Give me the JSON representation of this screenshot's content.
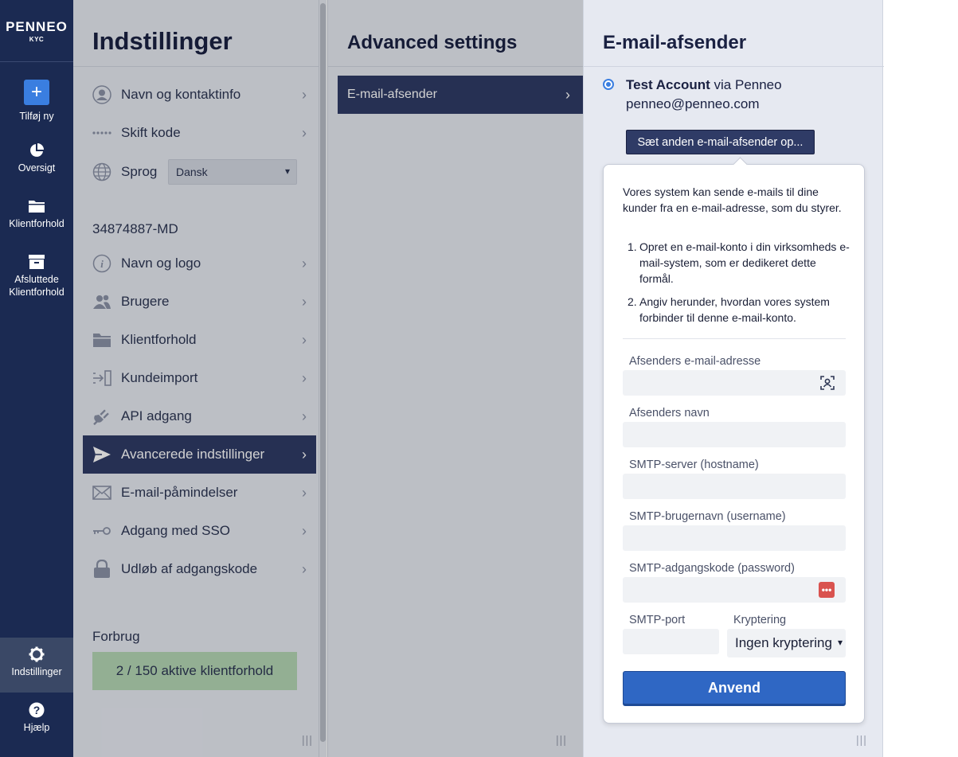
{
  "app": {
    "logo": "PENNEO",
    "logo_sub": "KYC"
  },
  "leftnav": {
    "add_label": "Tilføj ny",
    "overview_label": "Oversigt",
    "clients_label": "Klientforhold",
    "closed_label": "Afsluttede Klientforhold",
    "settings_label": "Indstillinger",
    "help_label": "Hjælp"
  },
  "settings": {
    "title": "Indstillinger",
    "personal_items": [
      {
        "label": "Navn og kontaktinfo",
        "icon": "user-icon"
      },
      {
        "label": "Skift kode",
        "icon": "password-dots-icon"
      }
    ],
    "language_label": "Sprog",
    "language_value": "Dansk",
    "org_id": "34874887-MD",
    "org_items": [
      {
        "label": "Navn og logo",
        "icon": "info-icon"
      },
      {
        "label": "Brugere",
        "icon": "users-icon"
      },
      {
        "label": "Klientforhold",
        "icon": "folder-icon"
      },
      {
        "label": "Kundeimport",
        "icon": "import-icon"
      },
      {
        "label": "API adgang",
        "icon": "plug-icon"
      },
      {
        "label": "Avancerede indstillinger",
        "icon": "send-icon",
        "active": true
      },
      {
        "label": "E-mail-påmindelser",
        "icon": "envelope-icon"
      },
      {
        "label": "Adgang med SSO",
        "icon": "key-icon"
      },
      {
        "label": "Udløb af adgangskode",
        "icon": "lock-icon"
      }
    ],
    "usage_title": "Forbrug",
    "usage_text": "2 / 150 aktive klientforhold"
  },
  "advanced": {
    "title": "Advanced settings",
    "item_label": "E-mail-afsender"
  },
  "email_sender": {
    "title": "E-mail-afsender",
    "account_name": "Test Account",
    "via_text": " via Penneo",
    "account_email": "penneo@penneo.com",
    "setup_button": "Sæt anden e-mail-afsender op...",
    "intro": "Vores system kan sende e-mails til dine kunder fra en e-mail-adresse, som du styrer.",
    "steps": [
      "Opret en e-mail-konto i din virksomheds e-mail-system, som er dedikeret dette formål.",
      "Angiv herunder, hvordan vores system forbinder til denne e-mail-konto."
    ],
    "fields": {
      "sender_email_label": "Afsenders e-mail-adresse",
      "sender_email_value": "",
      "sender_name_label": "Afsenders navn",
      "sender_name_value": "",
      "smtp_host_label": "SMTP-server (hostname)",
      "smtp_host_value": "",
      "smtp_user_label": "SMTP-brugernavn (username)",
      "smtp_user_value": "",
      "smtp_pass_label": "SMTP-adgangskode (password)",
      "smtp_pass_value": "",
      "smtp_port_label": "SMTP-port",
      "smtp_port_value": "",
      "encryption_label": "Kryptering",
      "encryption_value": "Ingen kryptering"
    },
    "apply_button": "Anvend"
  },
  "colors": {
    "nav_bg": "#1b2a52",
    "active_row": "#2f3b66",
    "accent": "#3a7ee0",
    "apply": "#2f67c4",
    "usage_bar": "#b4d6b4",
    "password_manager": "#d9534f"
  }
}
